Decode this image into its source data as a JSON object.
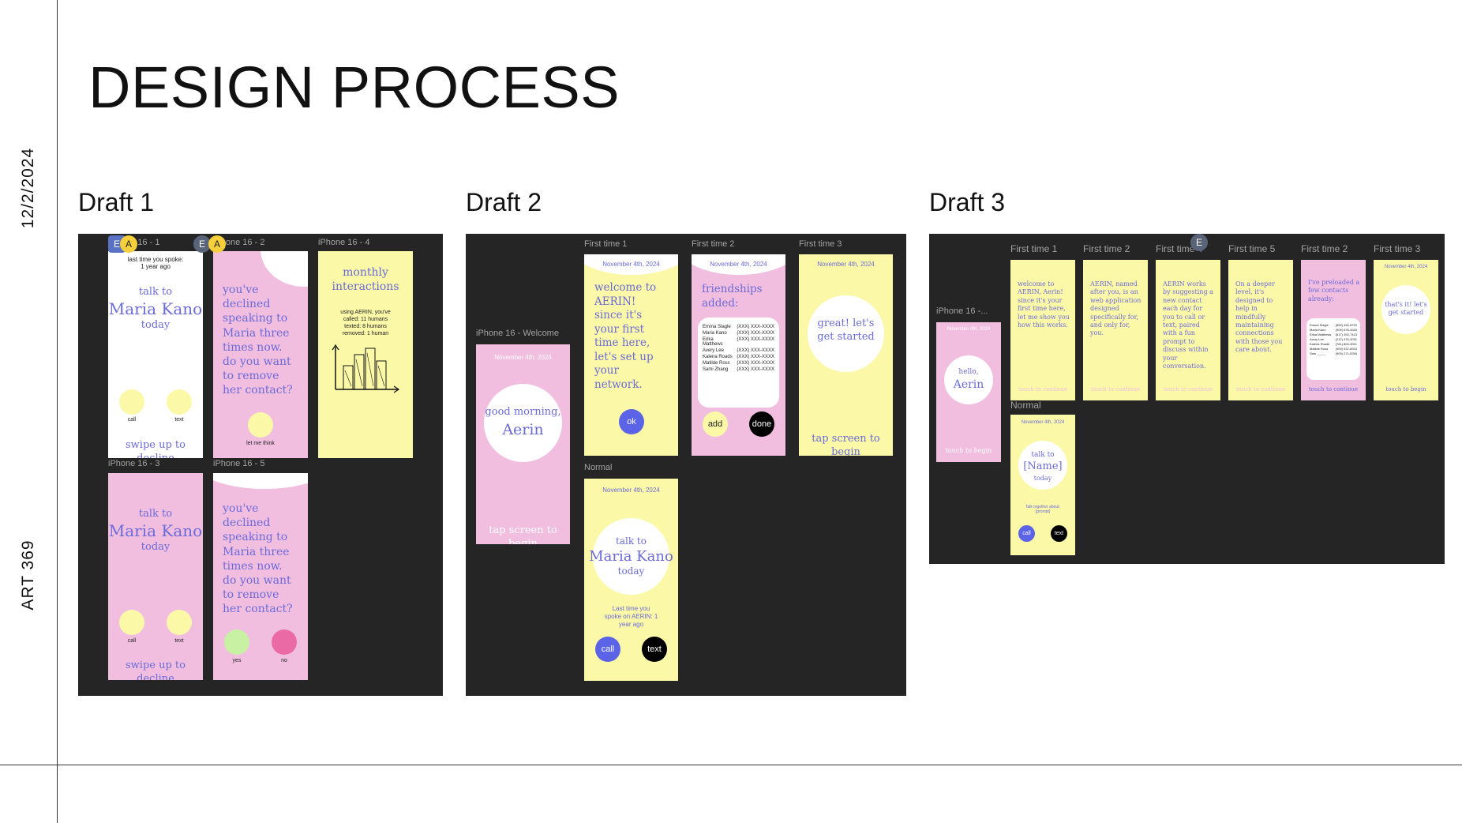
{
  "page": {
    "title": "DESIGN PROCESS",
    "date": "12/2/2024",
    "course": "ART  369"
  },
  "drafts": {
    "d1": {
      "label": "Draft 1"
    },
    "d2": {
      "label": "Draft 2"
    },
    "d3": {
      "label": "Draft 3"
    }
  },
  "collaborators": {
    "e": "E",
    "a": "A"
  },
  "d1": {
    "f1": {
      "label": "iPhone 16 - 1",
      "last_spoke": "last time you spoke:",
      "ago": "1 year ago",
      "talk_to": "talk to",
      "name": "Maria Kano",
      "today": "today",
      "call": "call",
      "text": "text",
      "swipe": "swipe up to decline"
    },
    "f2": {
      "label": "iPhone 16 - 2",
      "message": "you've declined speaking to Maria three times now. do you want to remove her contact?",
      "think": "let me think"
    },
    "f4": {
      "label": "iPhone 16 - 4",
      "title": "monthly interactions",
      "stats_intro": "using AERIN, you've",
      "called": "called: 11 humans",
      "texted": "texted: 8 humans",
      "removed": "removed: 1 human"
    },
    "f3": {
      "label": "iPhone 16 - 3",
      "talk_to": "talk to",
      "name": "Maria Kano",
      "today": "today",
      "call": "call",
      "text": "text",
      "swipe": "swipe up to decline"
    },
    "f5": {
      "label": "iPhone 16 - 5",
      "message": "you've declined speaking to Maria three times now. do you want to remove her contact?",
      "yes": "yes",
      "no": "no"
    }
  },
  "d2": {
    "welcome": {
      "label": "iPhone 16 - Welcome",
      "date": "November 4th, 2024",
      "greeting": "good morning,",
      "name": "Aerin",
      "tap": "tap screen to begin"
    },
    "ft1": {
      "label": "First time 1",
      "date": "November 4th, 2024",
      "message": "welcome to AERIN! since it's your first time here, let's set up your network.",
      "ok": "ok"
    },
    "ft2": {
      "label": "First time 2",
      "date": "November 4th, 2024",
      "title": "friendships added:",
      "contacts": [
        {
          "name": "Emma Slagle",
          "phone": "(XXX) XXX-XXXX"
        },
        {
          "name": "Maria Kano",
          "phone": "(XXX) XXX-XXXX"
        },
        {
          "name": "Erika Matthews",
          "phone": "(XXX) XXX-XXXX"
        },
        {
          "name": "Avery Lee",
          "phone": "(XXX) XXX-XXXX"
        },
        {
          "name": "Kalena Roads",
          "phone": "(XXX) XXX-XXXX"
        },
        {
          "name": "Matilde Ross",
          "phone": "(XXX) XXX-XXXX"
        },
        {
          "name": "Sami Zhang",
          "phone": "(XXX) XXX-XXXX"
        }
      ],
      "add": "add",
      "done": "done"
    },
    "ft3": {
      "label": "First time 3",
      "date": "November 4th, 2024",
      "message": "great! let's get started",
      "tap": "tap screen to begin"
    },
    "normal": {
      "label": "Normal",
      "date": "November 4th, 2024",
      "talk_to": "talk to",
      "name": "Maria Kano",
      "today": "today",
      "last_time": "Last time you spoke on AERIN: 1 year ago",
      "call": "call",
      "text": "text"
    }
  },
  "d3": {
    "iphone": {
      "label": "iPhone 16 -...",
      "date": "November 4th, 2024",
      "hello": "hello,",
      "name": "Aerin",
      "touch": "touch to begin"
    },
    "ft1": {
      "label": "First time 1",
      "message": "welcome to AERIN, Aerin! since it's your first time here, let me show you how this works.",
      "touch": "touch to continue"
    },
    "ft2": {
      "label": "First time 2",
      "message": "AERIN, named after you, is an web application designed specifically for, and only for, you.",
      "touch": "touch to continue"
    },
    "ft4": {
      "label": "First time 4",
      "message": "AERIN works by suggesting a new contact each day for you to call or text, paired with a fun prompt to discuss within your conversation.",
      "touch": "touch to continue"
    },
    "ft5": {
      "label": "First time 5",
      "message": "On a deeper level, it's designed to help in mindfully maintaining connections with those you care about.",
      "touch": "touch to continue"
    },
    "ft2b": {
      "label": "First time 2",
      "message": "I've preloaded a few contacts already:",
      "contacts": [
        {
          "name": "Emma Slagle",
          "phone": "(800) 452-8792"
        },
        {
          "name": "Maria Kano",
          "phone": "(909) 678-4943"
        },
        {
          "name": "Erika Matthews",
          "phone": "(617) 392-7413"
        },
        {
          "name": "Avery Lee",
          "phone": "(212) 476-3031"
        },
        {
          "name": "Kalena Roads",
          "phone": "(781) 804-3021"
        },
        {
          "name": "Matilde Ross",
          "phone": "(909) 537-6923"
        },
        {
          "name": "Sam _____",
          "phone": "(909) 271-5265"
        }
      ],
      "touch": "touch to continue"
    },
    "ft3": {
      "label": "First time 3",
      "date": "November 4th, 2024",
      "message": "that's it! let's get started",
      "touch": "touch to begin"
    },
    "normal": {
      "label": "Normal",
      "date": "November 4th, 2024",
      "talk_to": "talk to",
      "name": "[Name]",
      "today": "today",
      "prompt": "Talk together about: [prompt]",
      "call": "call",
      "text": "text"
    }
  },
  "colors": {
    "board": "#252525",
    "yellow": "#fbf9a8",
    "pink": "#f2bee0",
    "accent": "#6b6bd8",
    "button_blue": "#5b63e6",
    "yes_green": "#c9f1a3",
    "no_pink": "#ea6aa6"
  }
}
